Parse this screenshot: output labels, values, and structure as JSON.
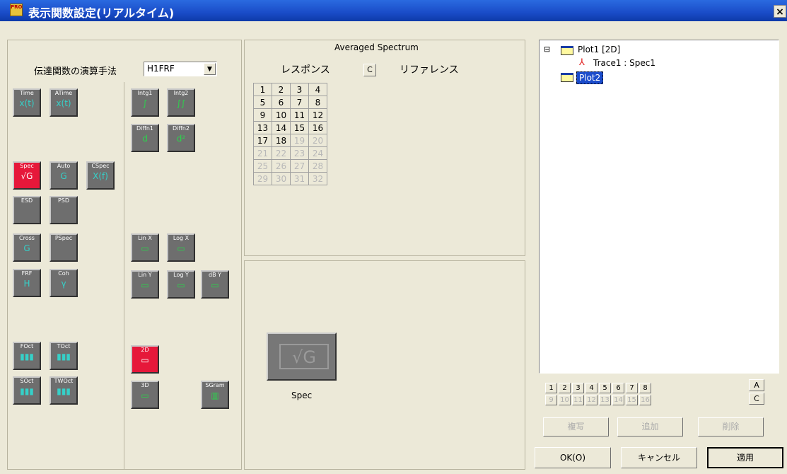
{
  "window": {
    "title": "表示関数設定(リアルタイム)",
    "close_label": "×",
    "icon_text": "PRO"
  },
  "left": {
    "method_label": "伝達関数の演算手法",
    "method_value": "H1FRF",
    "dropdown_arrow": "▼",
    "tiles_col1": [
      {
        "label": "Time",
        "sym": "x(t)"
      },
      {
        "label": "ATime",
        "sym": "x(t)"
      },
      {
        "label": "Spec",
        "sym": "√G",
        "red": true
      },
      {
        "label": "Auto",
        "sym": "G"
      },
      {
        "label": "CSpec",
        "sym": "X(f)"
      },
      {
        "label": "ESD",
        "sym": ""
      },
      {
        "label": "PSD",
        "sym": ""
      },
      {
        "label": "Cross",
        "sym": "G"
      },
      {
        "label": "PSpec",
        "sym": ""
      },
      {
        "label": "FRF",
        "sym": "H"
      },
      {
        "label": "Coh",
        "sym": "γ"
      },
      {
        "label": "FOct",
        "sym": "▮▮▮"
      },
      {
        "label": "TOct",
        "sym": "▮▮▮"
      },
      {
        "label": "SOct",
        "sym": "▮▮▮"
      },
      {
        "label": "TWOct",
        "sym": "▮▮▮"
      }
    ],
    "tiles_col2": [
      {
        "label": "Intg1",
        "sym": "∫"
      },
      {
        "label": "Intg2",
        "sym": "∫∫"
      },
      {
        "label": "Diffn1",
        "sym": "d"
      },
      {
        "label": "Diffn2",
        "sym": "d²"
      },
      {
        "label": "Lin X",
        "sym": "▭"
      },
      {
        "label": "Log X",
        "sym": "▭"
      },
      {
        "label": "Lin Y",
        "sym": "▭"
      },
      {
        "label": "Log Y",
        "sym": "▭"
      },
      {
        "label": "dB Y",
        "sym": "▭"
      },
      {
        "label": "2D",
        "sym": "▭",
        "red": true
      },
      {
        "label": "3D",
        "sym": "▭"
      },
      {
        "label": "SGram",
        "sym": "▥"
      }
    ]
  },
  "middle": {
    "heading": "Averaged Spectrum",
    "response_label": "レスポンス",
    "c_button": "C",
    "reference_label": "リファレンス",
    "grid": [
      [
        "1",
        "2",
        "3",
        "4"
      ],
      [
        "5",
        "6",
        "7",
        "8"
      ],
      [
        "9",
        "10",
        "11",
        "12"
      ],
      [
        "13",
        "14",
        "15",
        "16"
      ],
      [
        "17",
        "18",
        "19",
        "20"
      ],
      [
        "21",
        "22",
        "23",
        "24"
      ],
      [
        "25",
        "26",
        "27",
        "28"
      ],
      [
        "29",
        "30",
        "31",
        "32"
      ]
    ],
    "enabled_count": 18,
    "preview_label": "Spec",
    "preview_symbol": "√G"
  },
  "right": {
    "tree": [
      {
        "expander": "⊟",
        "label": "Plot1 [2D]",
        "level": 0
      },
      {
        "label": "Trace1 : Spec1",
        "level": 1
      },
      {
        "label": "Plot2",
        "level": 0,
        "selected": true
      }
    ],
    "numbers_row1": [
      "1",
      "2",
      "3",
      "4",
      "5",
      "6",
      "7",
      "8"
    ],
    "numbers_row2": [
      "9",
      "10",
      "11",
      "12",
      "13",
      "14",
      "15",
      "16"
    ],
    "a_button": "A",
    "c_button": "C",
    "copy_button": "複写",
    "add_button": "追加",
    "delete_button": "削除",
    "ok_button": "OK(O)",
    "cancel_button": "キャンセル",
    "apply_button": "適用"
  }
}
